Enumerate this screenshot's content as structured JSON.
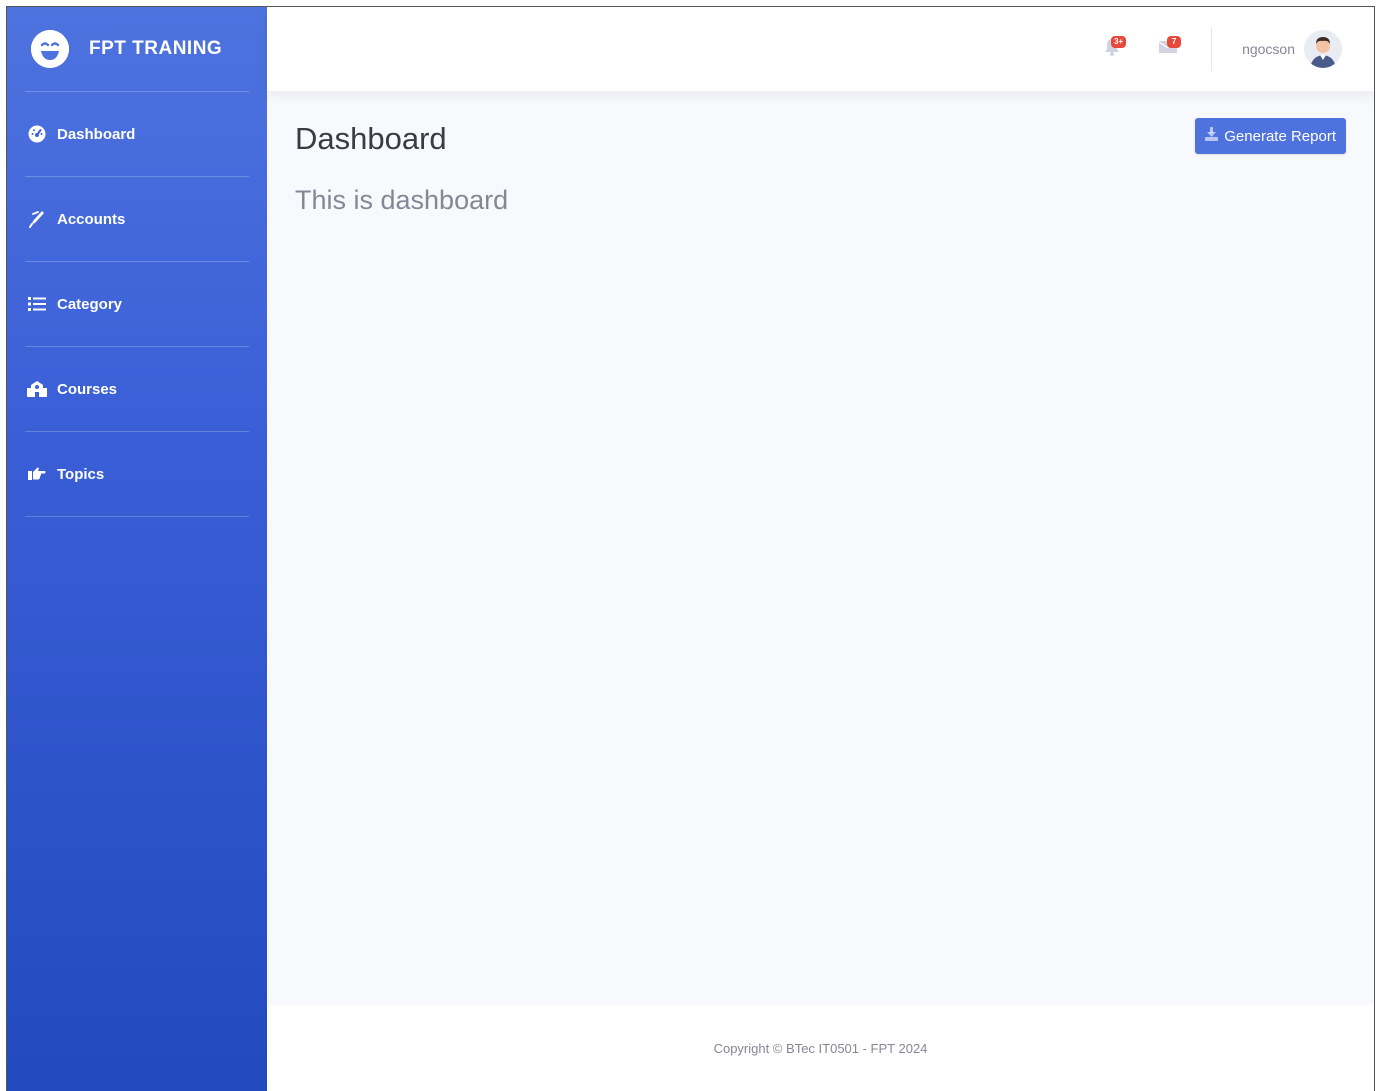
{
  "brand": {
    "title": "FPT TRANING"
  },
  "sidebar": {
    "items": [
      {
        "label": "Dashboard",
        "icon": "tachometer-icon"
      },
      {
        "label": "Accounts",
        "icon": "pen-icon"
      },
      {
        "label": "Category",
        "icon": "list-icon"
      },
      {
        "label": "Courses",
        "icon": "school-icon"
      },
      {
        "label": "Topics",
        "icon": "hand-point-right-icon"
      }
    ]
  },
  "topbar": {
    "alerts_badge": "3+",
    "messages_badge": "7",
    "username": "ngocson"
  },
  "main": {
    "title": "Dashboard",
    "text": "This is dashboard",
    "report_button": "Generate Report"
  },
  "footer": {
    "copyright": "Copyright © BTec IT0501 - FPT 2024"
  },
  "colors": {
    "primary": "#4e73df",
    "sidebar_end": "#224abe",
    "badge": "#e74a3b",
    "background": "#f8f9fc",
    "muted_text": "#858796"
  }
}
